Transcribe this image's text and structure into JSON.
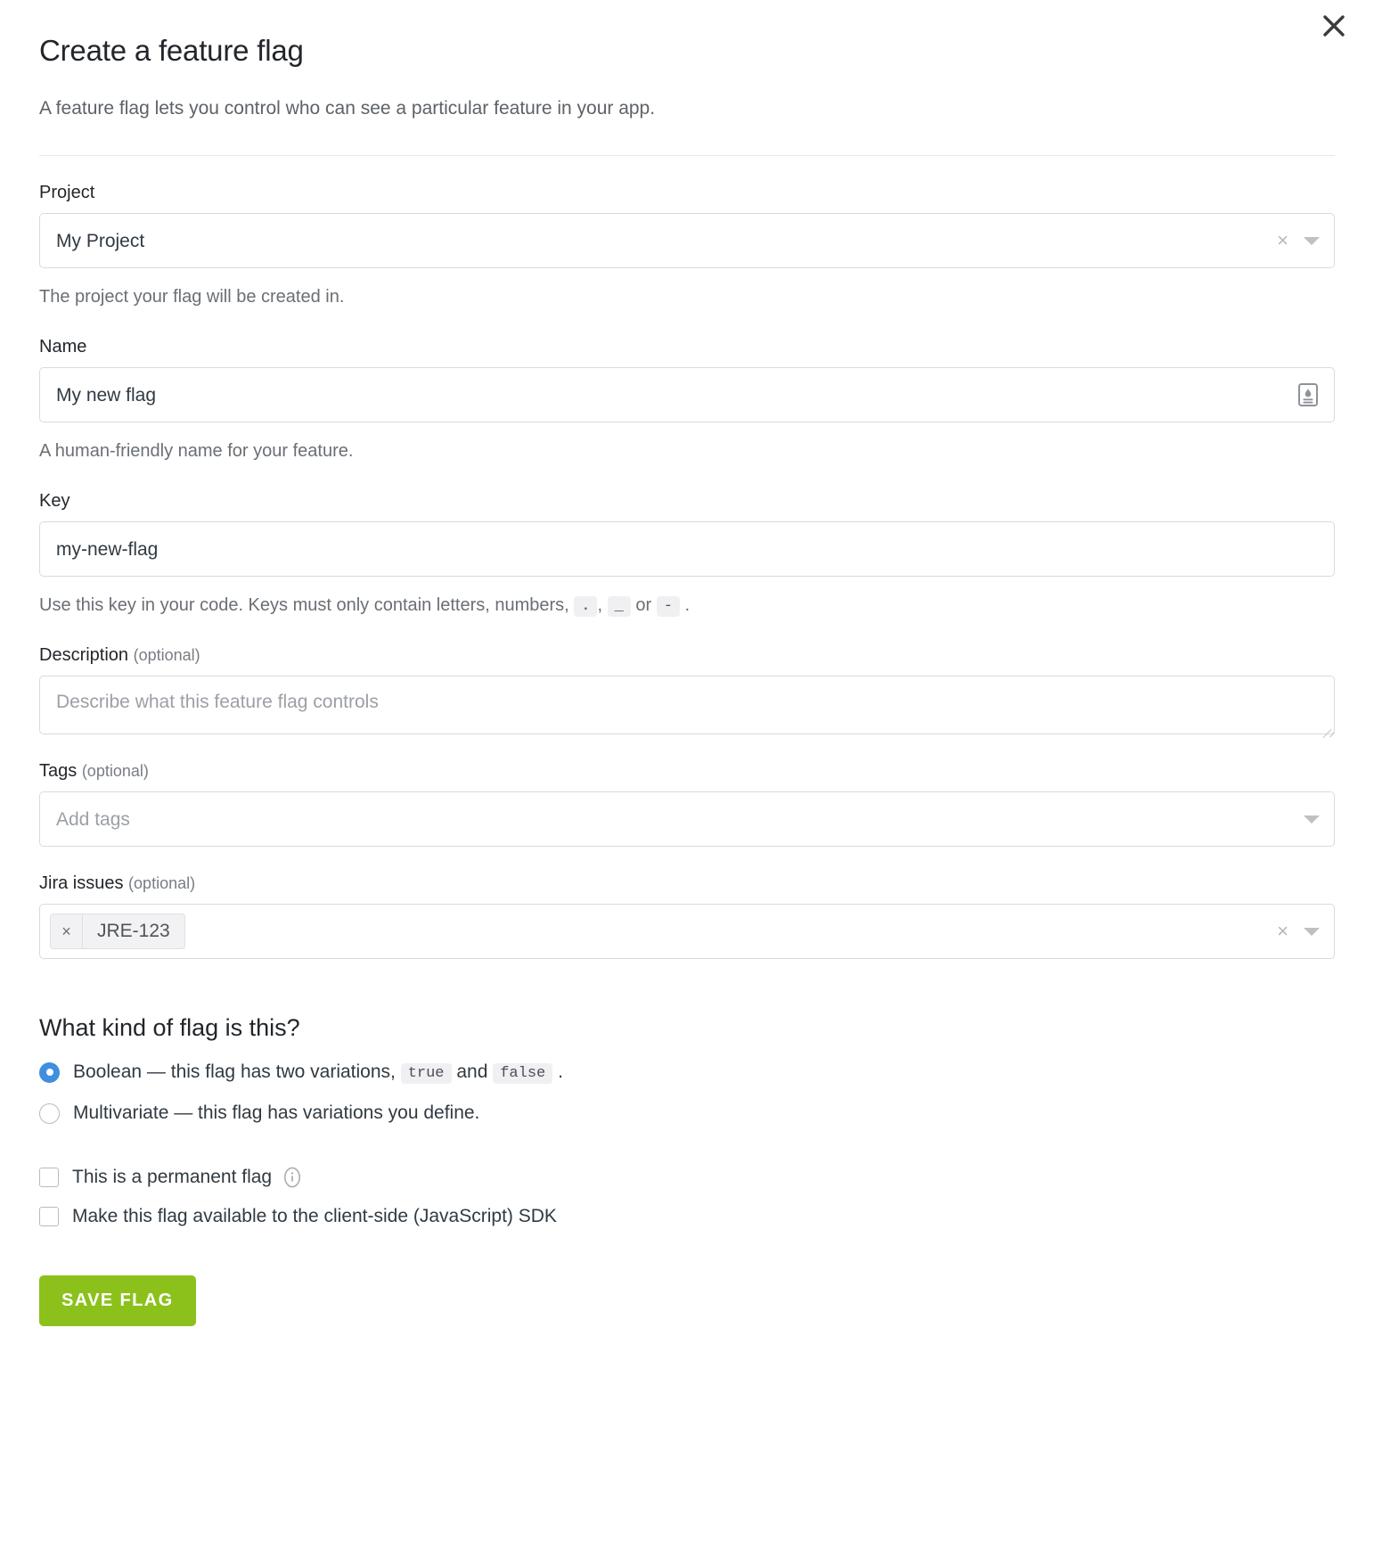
{
  "dialog": {
    "title": "Create a feature flag",
    "subtitle": "A feature flag lets you control who can see a particular feature in your app.",
    "close_icon": "close-icon"
  },
  "fields": {
    "project": {
      "label": "Project",
      "value": "My Project",
      "help": "The project your flag will be created in.",
      "clear_icon": "×",
      "caret_icon": "chevron-down-icon"
    },
    "name": {
      "label": "Name",
      "value": "My new flag",
      "help": "A human-friendly name for your feature.",
      "adornment_icon": "id-card-icon"
    },
    "key": {
      "label": "Key",
      "value": "my-new-flag",
      "help_prefix": "Use this key in your code. Keys must only contain letters, numbers, ",
      "chip_dot": ".",
      "help_sep1": ", ",
      "chip_underscore": "_",
      "help_sep2": " or ",
      "chip_hyphen": "-",
      "help_suffix": " ."
    },
    "description": {
      "label": "Description",
      "optional": "(optional)",
      "placeholder": "Describe what this feature flag controls",
      "value": ""
    },
    "tags": {
      "label": "Tags",
      "optional": "(optional)",
      "placeholder": "Add tags",
      "caret_icon": "chevron-down-icon"
    },
    "jira": {
      "label": "Jira issues",
      "optional": "(optional)",
      "tokens": [
        {
          "label": "JRE-123",
          "remove_icon": "×"
        }
      ],
      "clear_icon": "×",
      "caret_icon": "chevron-down-icon"
    }
  },
  "flag_kind": {
    "title": "What kind of flag is this?",
    "options": [
      {
        "selected": true,
        "text_before": "Boolean — this flag has two variations, ",
        "chip_true": "true",
        "text_middle": " and ",
        "chip_false": "false",
        "text_after": " ."
      },
      {
        "selected": false,
        "label": "Multivariate — this flag has variations you define."
      }
    ]
  },
  "checkboxes": [
    {
      "label": "This is a permanent flag",
      "checked": false,
      "has_info": true
    },
    {
      "label": "Make this flag available to the client-side (JavaScript) SDK",
      "checked": false,
      "has_info": false
    }
  ],
  "actions": {
    "save_label": "SAVE FLAG",
    "save_color": "#8cc11c"
  }
}
